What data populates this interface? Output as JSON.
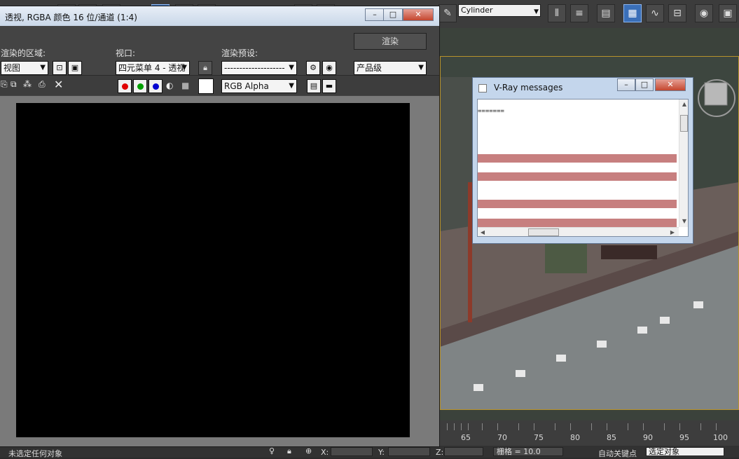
{
  "main_toolbar": {
    "object_type_value": "Cylinder"
  },
  "timeline": {
    "ticks": [
      "65",
      "70",
      "75",
      "80",
      "85",
      "90",
      "95",
      "100"
    ]
  },
  "status_bar": {
    "selection_text": "未选定任何对象",
    "x_label": "X:",
    "y_label": "Y:",
    "z_label": "Z:",
    "grid_text": "栅格 = 10.0",
    "auto_key_label": "自动关键点",
    "key_filter_value": "选定对象"
  },
  "frame_buffer": {
    "title": "透视, RGBA 颜色 16 位/通道 (1:4)",
    "area_label": "渲染的区域:",
    "area_value": "视图",
    "viewport_label": "视口:",
    "viewport_value": "四元菜单 4 - 透视",
    "preset_label": "渲染预设:",
    "preset_value": "--------------------",
    "render_button": "渲染",
    "quality_value": "产品级",
    "channel_value": "RGB Alpha",
    "colors": {
      "red": "#e00000",
      "green": "#00a000",
      "blue": "#0000d0",
      "image_bg": "#000000"
    }
  },
  "vray_window": {
    "title": "V-Ray messages",
    "first_line": "=======",
    "error_highlight_color": "#c77f7f"
  },
  "window_controls": {
    "minimize": "–",
    "maximize": "□",
    "close": "✕"
  }
}
